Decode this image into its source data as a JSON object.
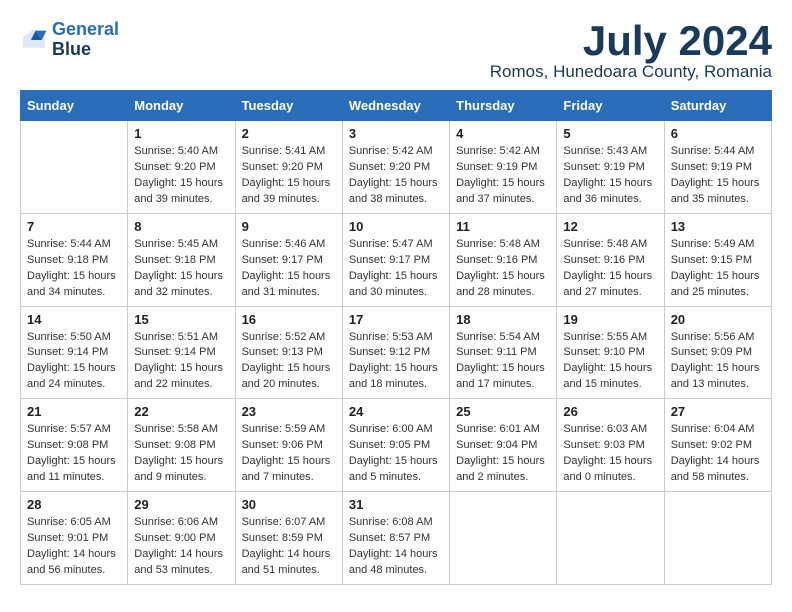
{
  "logo": {
    "line1": "General",
    "line2": "Blue"
  },
  "title": "July 2024",
  "location": "Romos, Hunedoara County, Romania",
  "weekdays": [
    "Sunday",
    "Monday",
    "Tuesday",
    "Wednesday",
    "Thursday",
    "Friday",
    "Saturday"
  ],
  "weeks": [
    [
      {
        "day": "",
        "sunrise": "",
        "sunset": "",
        "daylight": ""
      },
      {
        "day": "1",
        "sunrise": "Sunrise: 5:40 AM",
        "sunset": "Sunset: 9:20 PM",
        "daylight": "Daylight: 15 hours and 39 minutes."
      },
      {
        "day": "2",
        "sunrise": "Sunrise: 5:41 AM",
        "sunset": "Sunset: 9:20 PM",
        "daylight": "Daylight: 15 hours and 39 minutes."
      },
      {
        "day": "3",
        "sunrise": "Sunrise: 5:42 AM",
        "sunset": "Sunset: 9:20 PM",
        "daylight": "Daylight: 15 hours and 38 minutes."
      },
      {
        "day": "4",
        "sunrise": "Sunrise: 5:42 AM",
        "sunset": "Sunset: 9:19 PM",
        "daylight": "Daylight: 15 hours and 37 minutes."
      },
      {
        "day": "5",
        "sunrise": "Sunrise: 5:43 AM",
        "sunset": "Sunset: 9:19 PM",
        "daylight": "Daylight: 15 hours and 36 minutes."
      },
      {
        "day": "6",
        "sunrise": "Sunrise: 5:44 AM",
        "sunset": "Sunset: 9:19 PM",
        "daylight": "Daylight: 15 hours and 35 minutes."
      }
    ],
    [
      {
        "day": "7",
        "sunrise": "Sunrise: 5:44 AM",
        "sunset": "Sunset: 9:18 PM",
        "daylight": "Daylight: 15 hours and 34 minutes."
      },
      {
        "day": "8",
        "sunrise": "Sunrise: 5:45 AM",
        "sunset": "Sunset: 9:18 PM",
        "daylight": "Daylight: 15 hours and 32 minutes."
      },
      {
        "day": "9",
        "sunrise": "Sunrise: 5:46 AM",
        "sunset": "Sunset: 9:17 PM",
        "daylight": "Daylight: 15 hours and 31 minutes."
      },
      {
        "day": "10",
        "sunrise": "Sunrise: 5:47 AM",
        "sunset": "Sunset: 9:17 PM",
        "daylight": "Daylight: 15 hours and 30 minutes."
      },
      {
        "day": "11",
        "sunrise": "Sunrise: 5:48 AM",
        "sunset": "Sunset: 9:16 PM",
        "daylight": "Daylight: 15 hours and 28 minutes."
      },
      {
        "day": "12",
        "sunrise": "Sunrise: 5:48 AM",
        "sunset": "Sunset: 9:16 PM",
        "daylight": "Daylight: 15 hours and 27 minutes."
      },
      {
        "day": "13",
        "sunrise": "Sunrise: 5:49 AM",
        "sunset": "Sunset: 9:15 PM",
        "daylight": "Daylight: 15 hours and 25 minutes."
      }
    ],
    [
      {
        "day": "14",
        "sunrise": "Sunrise: 5:50 AM",
        "sunset": "Sunset: 9:14 PM",
        "daylight": "Daylight: 15 hours and 24 minutes."
      },
      {
        "day": "15",
        "sunrise": "Sunrise: 5:51 AM",
        "sunset": "Sunset: 9:14 PM",
        "daylight": "Daylight: 15 hours and 22 minutes."
      },
      {
        "day": "16",
        "sunrise": "Sunrise: 5:52 AM",
        "sunset": "Sunset: 9:13 PM",
        "daylight": "Daylight: 15 hours and 20 minutes."
      },
      {
        "day": "17",
        "sunrise": "Sunrise: 5:53 AM",
        "sunset": "Sunset: 9:12 PM",
        "daylight": "Daylight: 15 hours and 18 minutes."
      },
      {
        "day": "18",
        "sunrise": "Sunrise: 5:54 AM",
        "sunset": "Sunset: 9:11 PM",
        "daylight": "Daylight: 15 hours and 17 minutes."
      },
      {
        "day": "19",
        "sunrise": "Sunrise: 5:55 AM",
        "sunset": "Sunset: 9:10 PM",
        "daylight": "Daylight: 15 hours and 15 minutes."
      },
      {
        "day": "20",
        "sunrise": "Sunrise: 5:56 AM",
        "sunset": "Sunset: 9:09 PM",
        "daylight": "Daylight: 15 hours and 13 minutes."
      }
    ],
    [
      {
        "day": "21",
        "sunrise": "Sunrise: 5:57 AM",
        "sunset": "Sunset: 9:08 PM",
        "daylight": "Daylight: 15 hours and 11 minutes."
      },
      {
        "day": "22",
        "sunrise": "Sunrise: 5:58 AM",
        "sunset": "Sunset: 9:08 PM",
        "daylight": "Daylight: 15 hours and 9 minutes."
      },
      {
        "day": "23",
        "sunrise": "Sunrise: 5:59 AM",
        "sunset": "Sunset: 9:06 PM",
        "daylight": "Daylight: 15 hours and 7 minutes."
      },
      {
        "day": "24",
        "sunrise": "Sunrise: 6:00 AM",
        "sunset": "Sunset: 9:05 PM",
        "daylight": "Daylight: 15 hours and 5 minutes."
      },
      {
        "day": "25",
        "sunrise": "Sunrise: 6:01 AM",
        "sunset": "Sunset: 9:04 PM",
        "daylight": "Daylight: 15 hours and 2 minutes."
      },
      {
        "day": "26",
        "sunrise": "Sunrise: 6:03 AM",
        "sunset": "Sunset: 9:03 PM",
        "daylight": "Daylight: 15 hours and 0 minutes."
      },
      {
        "day": "27",
        "sunrise": "Sunrise: 6:04 AM",
        "sunset": "Sunset: 9:02 PM",
        "daylight": "Daylight: 14 hours and 58 minutes."
      }
    ],
    [
      {
        "day": "28",
        "sunrise": "Sunrise: 6:05 AM",
        "sunset": "Sunset: 9:01 PM",
        "daylight": "Daylight: 14 hours and 56 minutes."
      },
      {
        "day": "29",
        "sunrise": "Sunrise: 6:06 AM",
        "sunset": "Sunset: 9:00 PM",
        "daylight": "Daylight: 14 hours and 53 minutes."
      },
      {
        "day": "30",
        "sunrise": "Sunrise: 6:07 AM",
        "sunset": "Sunset: 8:59 PM",
        "daylight": "Daylight: 14 hours and 51 minutes."
      },
      {
        "day": "31",
        "sunrise": "Sunrise: 6:08 AM",
        "sunset": "Sunset: 8:57 PM",
        "daylight": "Daylight: 14 hours and 48 minutes."
      },
      {
        "day": "",
        "sunrise": "",
        "sunset": "",
        "daylight": ""
      },
      {
        "day": "",
        "sunrise": "",
        "sunset": "",
        "daylight": ""
      },
      {
        "day": "",
        "sunrise": "",
        "sunset": "",
        "daylight": ""
      }
    ]
  ]
}
